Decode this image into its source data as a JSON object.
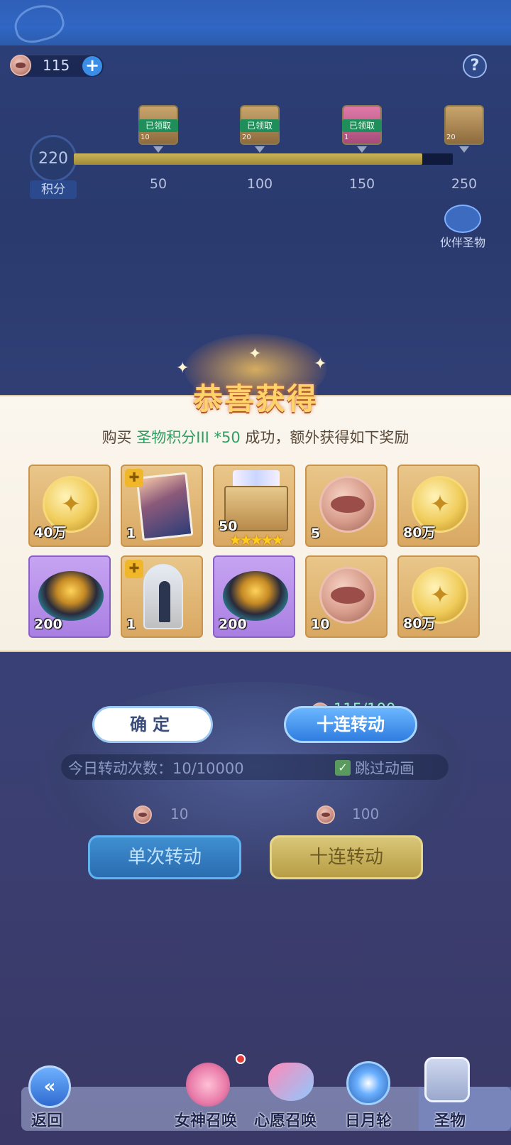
{
  "header": {
    "currency_value": "115",
    "plus_label": "+",
    "help_label": "?"
  },
  "progress": {
    "score": "220",
    "score_label": "积分",
    "fill_fraction": 0.92,
    "milestones": [
      {
        "value": "50",
        "status": "已领取",
        "count": "10"
      },
      {
        "value": "100",
        "status": "已领取",
        "count": "20"
      },
      {
        "value": "150",
        "status": "已领取",
        "count": "1"
      },
      {
        "value": "250",
        "status": "",
        "count": "20"
      }
    ]
  },
  "partner_relic": {
    "label": "伙伴圣物"
  },
  "dialog": {
    "title": "恭喜获得",
    "message_prefix": "购买 ",
    "message_item": "圣物积分III *50",
    "message_suffix": " 成功，额外获得如下奖励",
    "rewards": [
      {
        "type": "gold-coin",
        "count": "40万",
        "bg": "gold"
      },
      {
        "type": "character-card",
        "count": "1",
        "bg": "gold",
        "puzzle": true
      },
      {
        "type": "card-chest",
        "count": "50",
        "bg": "gold",
        "stars": "★★★★★"
      },
      {
        "type": "lips-coin",
        "count": "5",
        "bg": "gold"
      },
      {
        "type": "gold-coin",
        "count": "80万",
        "bg": "gold"
      },
      {
        "type": "ore",
        "count": "200",
        "bg": "purple"
      },
      {
        "type": "figurine-dome",
        "count": "1",
        "bg": "gold",
        "puzzle": true
      },
      {
        "type": "ore",
        "count": "200",
        "bg": "purple"
      },
      {
        "type": "lips-coin",
        "count": "10",
        "bg": "gold"
      },
      {
        "type": "gold-coin",
        "count": "80万",
        "bg": "gold"
      }
    ]
  },
  "actions": {
    "confirm_label": "确定",
    "ten_spin_top_label": "十连转动",
    "ten_spin_cost_display": "115/100",
    "today_count_label": "今日转动次数：10/10000",
    "skip_animation_label": "跳过动画",
    "single_cost": "10",
    "ten_cost": "100",
    "single_spin_label": "单次转动",
    "ten_spin_label": "十连转动"
  },
  "bottom_nav": {
    "back": "返回",
    "goddess": "女神召唤",
    "wish": "心愿召唤",
    "sun_moon": "日月轮",
    "relic": "圣物"
  },
  "colors": {
    "claimed_tag": "#1f8e5b",
    "dialog_highlight": "#2e9e62",
    "cost_green": "#8ff0c4"
  }
}
